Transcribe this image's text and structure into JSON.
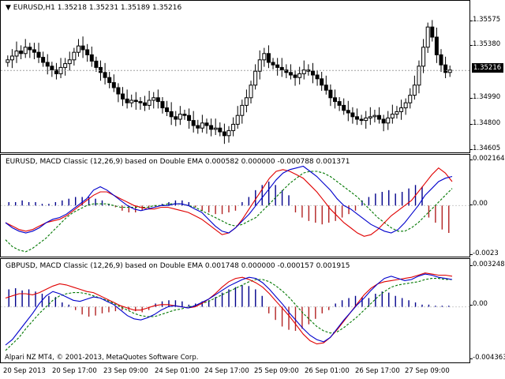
{
  "main": {
    "header": "EURUSD,H1  1.35218 1.35231 1.35189 1.35216",
    "price_ticks": [
      "1.35575",
      "1.35380",
      "1.34990",
      "1.34800",
      "1.34605"
    ],
    "current_price": "1.35216",
    "closes": [
      1.353,
      1.3533,
      1.3537,
      1.3535,
      1.354,
      1.3538,
      1.3536,
      1.3532,
      1.3528,
      1.3525,
      1.3522,
      1.3519,
      1.3524,
      1.3527,
      1.353,
      1.3536,
      1.3541,
      1.3538,
      1.3534,
      1.3529,
      1.3524,
      1.352,
      1.3516,
      1.3512,
      1.3508,
      1.3503,
      1.3499,
      1.3496,
      1.3498,
      1.3497,
      1.3496,
      1.3494,
      1.3498,
      1.35,
      1.3497,
      1.3492,
      1.3489,
      1.3485,
      1.3483,
      1.3487,
      1.3486,
      1.3482,
      1.3478,
      1.3476,
      1.348,
      1.3478,
      1.3475,
      1.3476,
      1.3473,
      1.347,
      1.3474,
      1.3479,
      1.3486,
      1.3494,
      1.35,
      1.351,
      1.3521,
      1.353,
      1.3535,
      1.3528,
      1.3526,
      1.3524,
      1.3522,
      1.352,
      1.3518,
      1.3516,
      1.3519,
      1.3522,
      1.3521,
      1.3518,
      1.3515,
      1.351,
      1.3506,
      1.35,
      1.3497,
      1.3494,
      1.349,
      1.3488,
      1.3485,
      1.3483,
      1.3482,
      1.3484,
      1.3485,
      1.3486,
      1.3483,
      1.348,
      1.3484,
      1.3487,
      1.3489,
      1.3492,
      1.3496,
      1.3502,
      1.351,
      1.3525,
      1.354,
      1.3556,
      1.3548,
      1.3534,
      1.3526,
      1.352,
      1.3522
    ]
  },
  "macd1": {
    "header": "EURUSD, MACD Classic (12,26,9) based on Double EMA 0.000582 0.000000 -0.000788 0.001371",
    "ticks": [
      "0.002164",
      "0.00",
      "-0.0023"
    ],
    "macd": [
      -1.0,
      -1.3,
      -1.5,
      -1.6,
      -1.5,
      -1.3,
      -1.0,
      -0.8,
      -0.7,
      -0.5,
      -0.2,
      0.1,
      0.4,
      0.9,
      1.1,
      0.9,
      0.6,
      0.3,
      0.0,
      -0.2,
      -0.3,
      -0.2,
      -0.1,
      0.0,
      0.0,
      0.1,
      0.1,
      0.0,
      -0.2,
      -0.4,
      -0.8,
      -1.2,
      -1.5,
      -1.6,
      -1.3,
      -0.9,
      -0.5,
      0.0,
      0.5,
      1.0,
      1.5,
      1.9,
      2.1,
      2.2,
      2.3,
      2.0,
      1.7,
      1.3,
      0.9,
      0.4,
      0.0,
      -0.2,
      -0.5,
      -0.8,
      -1.1,
      -1.3,
      -1.5,
      -1.6,
      -1.4,
      -1.0,
      -0.5,
      0.0,
      0.6,
      1.0,
      1.4,
      1.6,
      1.7
    ],
    "signal": [
      -2.0,
      -2.4,
      -2.6,
      -2.7,
      -2.5,
      -2.2,
      -1.9,
      -1.5,
      -1.1,
      -0.7,
      -0.4,
      -0.2,
      0.0,
      0.1,
      0.1,
      0.1,
      0.0,
      -0.1,
      -0.1,
      -0.1,
      -0.1,
      -0.1,
      0.0,
      0.0,
      0.1,
      0.1,
      0.1,
      0.0,
      -0.1,
      -0.3,
      -0.5,
      -0.7,
      -0.9,
      -1.1,
      -1.2,
      -1.1,
      -0.9,
      -0.7,
      -0.3,
      0.1,
      0.5,
      0.9,
      1.3,
      1.6,
      1.9,
      2.0,
      2.0,
      1.9,
      1.7,
      1.4,
      1.1,
      0.8,
      0.5,
      0.1,
      -0.3,
      -0.7,
      -1.0,
      -1.3,
      -1.5,
      -1.5,
      -1.3,
      -1.0,
      -0.6,
      -0.2,
      0.2,
      0.6,
      1.0
    ],
    "red_line": [
      -1.0,
      -1.2,
      -1.4,
      -1.5,
      -1.4,
      -1.2,
      -1.0,
      -0.9,
      -0.8,
      -0.6,
      -0.3,
      0.0,
      0.3,
      0.6,
      0.8,
      0.8,
      0.6,
      0.4,
      0.2,
      0.0,
      -0.1,
      -0.2,
      -0.2,
      -0.1,
      -0.1,
      -0.2,
      -0.3,
      -0.4,
      -0.6,
      -0.8,
      -1.1,
      -1.4,
      -1.7,
      -1.6,
      -1.3,
      -0.8,
      -0.2,
      0.4,
      1.0,
      1.6,
      2.0,
      2.1,
      2.0,
      1.8,
      1.6,
      1.2,
      0.8,
      0.3,
      -0.2,
      -0.6,
      -1.0,
      -1.3,
      -1.6,
      -1.8,
      -1.7,
      -1.4,
      -1.0,
      -0.6,
      -0.3,
      0.0,
      0.3,
      0.8,
      1.3,
      1.8,
      2.2,
      1.9,
      1.4
    ],
    "histogram": [
      0.2,
      0.2,
      0.3,
      0.2,
      0.2,
      0.1,
      0.1,
      0.2,
      0.3,
      0.4,
      0.5,
      0.5,
      0.5,
      0.4,
      0.3,
      0.1,
      -0.1,
      -0.3,
      -0.4,
      -0.4,
      -0.3,
      -0.2,
      -0.1,
      0.1,
      0.2,
      0.3,
      0.3,
      0.2,
      -0.1,
      -0.3,
      -0.4,
      -0.5,
      -0.5,
      -0.4,
      -0.3,
      0.2,
      0.5,
      0.9,
      1.2,
      1.4,
      1.2,
      0.9,
      0.6,
      -0.4,
      -0.7,
      -0.9,
      -1.0,
      -1.1,
      -1.0,
      -0.9,
      -0.7,
      -0.5,
      -0.3,
      0.3,
      0.5,
      0.7,
      0.8,
      0.9,
      0.7,
      0.8,
      1.0,
      1.2,
      1.1,
      -0.7,
      -1.0,
      -1.4,
      -1.6
    ]
  },
  "macd2": {
    "header": "GBPUSD, MACD Classic (12,26,9) based on Double EMA 0.001748 0.000000 -0.000157 0.001915",
    "ticks": [
      "0.003248",
      "0.00",
      "-0.004363"
    ],
    "macd": [
      -3.5,
      -3.0,
      -2.2,
      -1.4,
      -0.6,
      0.3,
      1.0,
      1.4,
      1.2,
      0.9,
      0.6,
      0.5,
      0.7,
      0.9,
      0.8,
      0.5,
      0.2,
      -0.3,
      -0.8,
      -1.1,
      -1.2,
      -1.0,
      -0.7,
      -0.3,
      0.0,
      0.1,
      0.0,
      -0.1,
      0.1,
      0.4,
      0.7,
      1.1,
      1.5,
      1.9,
      2.2,
      2.5,
      2.7,
      2.6,
      2.2,
      1.6,
      0.9,
      0.2,
      -0.6,
      -1.3,
      -2.0,
      -2.6,
      -3.0,
      -3.2,
      -2.8,
      -2.0,
      -1.2,
      -0.5,
      0.2,
      0.8,
      1.5,
      2.1,
      2.6,
      2.8,
      2.6,
      2.4,
      2.5,
      2.8,
      3.0,
      2.9,
      2.7,
      2.6,
      2.5
    ],
    "signal": [
      -4.0,
      -3.4,
      -2.8,
      -2.0,
      -1.3,
      -0.6,
      0.0,
      0.6,
      1.0,
      1.2,
      1.3,
      1.3,
      1.2,
      1.0,
      0.8,
      0.6,
      0.3,
      0.0,
      -0.3,
      -0.6,
      -0.8,
      -0.9,
      -0.9,
      -0.7,
      -0.5,
      -0.3,
      -0.2,
      0.0,
      0.1,
      0.3,
      0.5,
      0.8,
      1.1,
      1.4,
      1.7,
      2.0,
      2.3,
      2.5,
      2.5,
      2.3,
      1.9,
      1.4,
      0.8,
      0.1,
      -0.6,
      -1.2,
      -1.8,
      -2.2,
      -2.4,
      -2.3,
      -1.9,
      -1.4,
      -0.9,
      -0.3,
      0.3,
      0.9,
      1.4,
      1.8,
      2.0,
      2.1,
      2.2,
      2.3,
      2.5,
      2.6,
      2.6,
      2.5,
      2.5
    ],
    "red_line": [
      0.8,
      1.0,
      1.2,
      1.2,
      1.1,
      1.3,
      1.6,
      1.9,
      2.1,
      2.0,
      1.8,
      1.6,
      1.4,
      1.3,
      1.0,
      0.7,
      0.4,
      0.1,
      -0.1,
      -0.3,
      -0.3,
      -0.1,
      0.1,
      0.2,
      0.2,
      0.1,
      0.0,
      -0.1,
      0.0,
      0.3,
      0.7,
      1.2,
      1.8,
      2.3,
      2.6,
      2.7,
      2.5,
      2.2,
      1.8,
      1.2,
      0.5,
      -0.2,
      -0.9,
      -1.7,
      -2.5,
      -3.1,
      -3.4,
      -3.3,
      -2.8,
      -2.1,
      -1.3,
      -0.5,
      0.3,
      1.1,
      1.7,
      2.1,
      2.3,
      2.4,
      2.5,
      2.6,
      2.7,
      2.9,
      3.1,
      3.0,
      2.9,
      2.9,
      2.8
    ],
    "histogram": [
      1.6,
      1.7,
      1.5,
      1.6,
      1.4,
      1.2,
      1.0,
      0.9,
      0.4,
      0.2,
      -0.3,
      -0.7,
      -0.9,
      -0.8,
      -0.6,
      -0.5,
      -0.4,
      -0.3,
      -0.3,
      -0.4,
      -0.5,
      -0.3,
      0.3,
      0.5,
      0.6,
      0.6,
      0.5,
      0.2,
      0.3,
      0.5,
      0.6,
      0.9,
      1.3,
      1.6,
      1.8,
      2.0,
      1.9,
      1.6,
      1.0,
      -0.6,
      -1.2,
      -1.8,
      -2.1,
      -2.2,
      -2.0,
      -1.6,
      -1.1,
      -0.6,
      -0.3,
      0.3,
      0.6,
      0.8,
      1.0,
      0.9,
      0.8,
      1.2,
      1.4,
      1.3,
      1.0,
      0.8,
      0.6,
      0.4,
      0.2,
      0.2,
      0.1,
      0.1,
      0.1
    ]
  },
  "time_labels": [
    "20 Sep 2013",
    "20 Sep 17:00",
    "23 Sep 09:00",
    "24 Sep 01:00",
    "24 Sep 17:00",
    "25 Sep 09:00",
    "26 Sep 01:00",
    "26 Sep 17:00",
    "27 Sep 09:00"
  ],
  "copyright": "Alpari NZ MT4, © 2001-2013, MetaQuotes Software Corp.",
  "colors": {
    "macd": "#0000cc",
    "signal": "#007700",
    "red": "#e00000",
    "hist_pos": "#00008b",
    "hist_neg": "#b22222",
    "candle": "#000000"
  }
}
